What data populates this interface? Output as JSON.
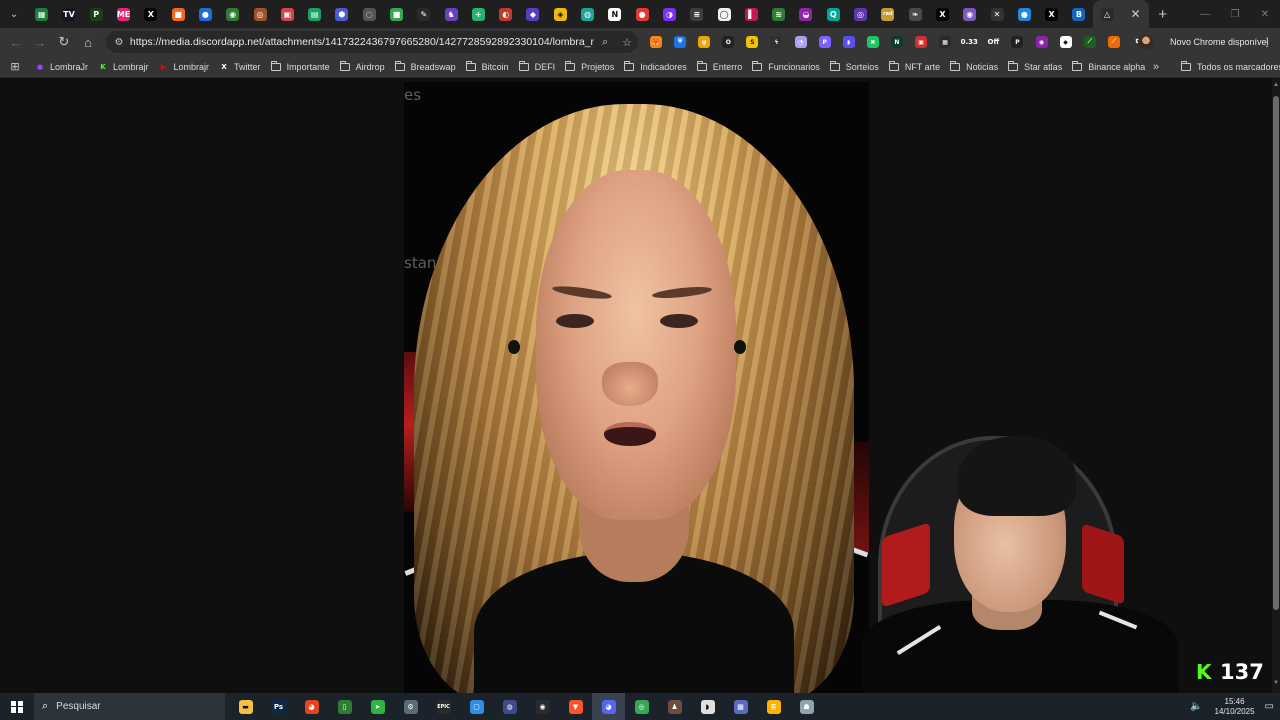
{
  "browser": {
    "tabs": [
      {
        "icon": "sheets-icon",
        "color": "#188038",
        "glyph": "▦"
      },
      {
        "icon": "tradingview-icon",
        "color": "#131722",
        "glyph": "TV"
      },
      {
        "icon": "pokemon-icon",
        "color": "#1e3d1e",
        "glyph": "P"
      },
      {
        "icon": "magiceden-icon",
        "color": "#e42575",
        "glyph": "ME"
      },
      {
        "icon": "x-icon",
        "color": "#000000",
        "glyph": "X"
      },
      {
        "icon": "orange-square-icon",
        "color": "#f26722",
        "glyph": "■"
      },
      {
        "icon": "drop-icon",
        "color": "#1c6fd6",
        "glyph": "●"
      },
      {
        "icon": "green-orb-icon",
        "color": "#2f7d32",
        "glyph": "◉"
      },
      {
        "icon": "bronze-coin-icon",
        "color": "#a0522d",
        "glyph": "◎"
      },
      {
        "icon": "red-square-icon",
        "color": "#d64545",
        "glyph": "▣"
      },
      {
        "icon": "green-sheet-icon",
        "color": "#1aa260",
        "glyph": "▤"
      },
      {
        "icon": "blue-hex-icon",
        "color": "#4a5bd6",
        "glyph": "⬢"
      },
      {
        "icon": "grey-circle-icon",
        "color": "#555555",
        "glyph": "◌"
      },
      {
        "icon": "green-tab-icon",
        "color": "#34a853",
        "glyph": "■"
      },
      {
        "icon": "quill-icon",
        "color": "#2a2a2a",
        "glyph": "✎"
      },
      {
        "icon": "purple-wizard-icon",
        "color": "#6a3fc1",
        "glyph": "♞"
      },
      {
        "icon": "green-plus-icon",
        "color": "#21b573",
        "glyph": "+"
      },
      {
        "icon": "swirl-icon",
        "color": "#c0392b",
        "glyph": "◐"
      },
      {
        "icon": "purple-diamond-icon",
        "color": "#5b3cc4",
        "glyph": "◆"
      },
      {
        "icon": "binance-icon",
        "color": "#f0b90b",
        "glyph": "◈"
      },
      {
        "icon": "teal-globe-icon",
        "color": "#1ba39c",
        "glyph": "◍"
      },
      {
        "icon": "notion-icon",
        "color": "#ffffff",
        "glyph": "N"
      },
      {
        "icon": "red-dot-icon",
        "color": "#e53935",
        "glyph": "●"
      },
      {
        "icon": "purple-moon-icon",
        "color": "#7b2ff7",
        "glyph": "◑"
      },
      {
        "icon": "lines-icon",
        "color": "#3d3d3d",
        "glyph": "≡"
      },
      {
        "icon": "white-circle-icon",
        "color": "#f2f2f2",
        "glyph": "◯"
      },
      {
        "icon": "magenta-bar-icon",
        "color": "#c2185b",
        "glyph": "▌"
      },
      {
        "icon": "green-wave-icon",
        "color": "#2e7d32",
        "glyph": "≋"
      },
      {
        "icon": "purple-swirl-icon",
        "color": "#8e24aa",
        "glyph": "◒"
      },
      {
        "icon": "teal-q-icon",
        "color": "#00a896",
        "glyph": "Q"
      },
      {
        "icon": "violet-token-icon",
        "color": "#5e35b1",
        "glyph": "◎"
      },
      {
        "icon": "rad-icon",
        "color": "#c99a2e",
        "glyph": "rad"
      },
      {
        "icon": "grey-leaf-icon",
        "color": "#4a4a4a",
        "glyph": "❧"
      },
      {
        "icon": "x-icon",
        "color": "#000000",
        "glyph": "X"
      },
      {
        "icon": "purple-ring-icon",
        "color": "#7e57c2",
        "glyph": "◉"
      },
      {
        "icon": "crossed-icon",
        "color": "#333333",
        "glyph": "✕"
      },
      {
        "icon": "blue-drop-icon",
        "color": "#1e88e5",
        "glyph": "●"
      },
      {
        "icon": "x-icon",
        "color": "#000000",
        "glyph": "X"
      },
      {
        "icon": "blue-b-icon",
        "color": "#1565c0",
        "glyph": "B"
      }
    ],
    "active_tab": {
      "icon": "drive-icon",
      "color": "#2a2a2a",
      "glyph": "△"
    },
    "url": "https://media.discordapp.net/attachments/1417322436797665280/1427728592892330104/lombra_rocha_da...",
    "extensions": [
      {
        "icon": "fox-icon",
        "color": "#f6851b",
        "glyph": "🦊"
      },
      {
        "icon": "shield-icon",
        "color": "#1a73e8",
        "glyph": "⛨"
      },
      {
        "icon": "phantom-icon",
        "color": "#f0a400",
        "glyph": "ψ"
      },
      {
        "icon": "o-icon",
        "color": "#222222",
        "glyph": "O"
      },
      {
        "icon": "s-icon",
        "color": "#f2c200",
        "glyph": "S"
      },
      {
        "icon": "lightning-icon",
        "color": "#303030",
        "glyph": "ϟ"
      },
      {
        "icon": "ghost-icon",
        "color": "#ab9ff2",
        "glyph": "◔"
      },
      {
        "icon": "p-icon",
        "color": "#7b61ff",
        "glyph": "P"
      },
      {
        "icon": "rabbit-icon",
        "color": "#5a4ff2",
        "glyph": "◗"
      },
      {
        "icon": "x-green-icon",
        "color": "#18c964",
        "glyph": "✖"
      },
      {
        "icon": "n-icon",
        "color": "#0c3b2e",
        "glyph": "N"
      },
      {
        "icon": "red-bag-icon",
        "color": "#d32f2f",
        "glyph": "▣"
      },
      {
        "icon": "qr-icon",
        "color": "#2a2a2a",
        "glyph": "▦"
      },
      {
        "icon": "counter-icon",
        "color": "#2a2a2a",
        "glyph": "0.33"
      },
      {
        "icon": "off-icon",
        "color": "#2a2a2a",
        "glyph": "Off"
      },
      {
        "icon": "p-black-icon",
        "color": "#212121",
        "glyph": "P"
      },
      {
        "icon": "violet-circle-icon",
        "color": "#8e24aa",
        "glyph": "◉"
      },
      {
        "icon": "diamond-icon",
        "color": "#ffffff",
        "glyph": "◆"
      },
      {
        "icon": "chart-icon",
        "color": "#1b5e20",
        "glyph": "⟋"
      },
      {
        "icon": "orange-slash-icon",
        "color": "#ef6c00",
        "glyph": "⟋"
      },
      {
        "icon": "puzzle-icon",
        "color": "#353535",
        "glyph": "⧉"
      }
    ],
    "update_label": "Novo Chrome disponível",
    "bookmarks": [
      {
        "type": "site",
        "label": "LombraJr",
        "icon": "purple-avatar-icon",
        "color": "#9146ff",
        "glyph": "●"
      },
      {
        "type": "site",
        "label": "Lombrajr",
        "icon": "kick-icon",
        "color": "#53fc18",
        "glyph": "K"
      },
      {
        "type": "site",
        "label": "Lombrajr",
        "icon": "youtube-icon",
        "color": "#ff0000",
        "glyph": "▶"
      },
      {
        "type": "site",
        "label": "Twitter",
        "icon": "x-icon",
        "color": "#ffffff",
        "glyph": "X"
      },
      {
        "type": "folder",
        "label": "Importante"
      },
      {
        "type": "folder",
        "label": "Airdrop"
      },
      {
        "type": "folder",
        "label": "Breadswap"
      },
      {
        "type": "folder",
        "label": "Bitcoin"
      },
      {
        "type": "folder",
        "label": "DEFI"
      },
      {
        "type": "folder",
        "label": "Projetos"
      },
      {
        "type": "folder",
        "label": "Indicadores"
      },
      {
        "type": "folder",
        "label": "Enterro"
      },
      {
        "type": "folder",
        "label": "Funcionarios"
      },
      {
        "type": "folder",
        "label": "Sorteios"
      },
      {
        "type": "folder",
        "label": "NFT arte"
      },
      {
        "type": "folder",
        "label": "Noticias"
      },
      {
        "type": "folder",
        "label": "Star atlas"
      },
      {
        "type": "folder",
        "label": "Binance alpha"
      }
    ],
    "all_bookmarks_label": "Todos os marcadores"
  },
  "video": {
    "ghost_text_top": "es",
    "ghost_text_mid": "stando"
  },
  "stream_overlay": {
    "viewer_count": "137",
    "kick_color": "#53fc18"
  },
  "taskbar": {
    "search_placeholder": "Pesquisar",
    "apps": [
      {
        "icon": "file-explorer-icon",
        "color": "#f4c145",
        "glyph": "▬",
        "active": false
      },
      {
        "icon": "photoshop-icon",
        "color": "#0b2a4a",
        "glyph": "Ps",
        "active": false
      },
      {
        "icon": "obs-like-icon",
        "color": "#e2461f",
        "glyph": "◕",
        "active": false
      },
      {
        "icon": "book-app-icon",
        "color": "#2e7d32",
        "glyph": "▯",
        "active": false
      },
      {
        "icon": "green-arrow-icon",
        "color": "#2fb344",
        "glyph": "➤",
        "active": false
      },
      {
        "icon": "steam-icon",
        "color": "#5a6b7a",
        "glyph": "⚙",
        "active": false
      },
      {
        "icon": "epic-games-icon",
        "color": "#2a2a2a",
        "glyph": "EPIC",
        "active": false
      },
      {
        "icon": "blue-app-icon",
        "color": "#2f8de4",
        "glyph": "▢",
        "active": false
      },
      {
        "icon": "launcher-icon",
        "color": "#3e4a8a",
        "glyph": "◍",
        "active": false
      },
      {
        "icon": "obs-icon",
        "color": "#2b2b2b",
        "glyph": "◉",
        "active": false
      },
      {
        "icon": "brave-icon",
        "color": "#fb542b",
        "glyph": "▼",
        "active": false
      },
      {
        "icon": "discord-icon",
        "color": "#5865f2",
        "glyph": "◕",
        "active": true
      },
      {
        "icon": "chrome-icon",
        "color": "#34a853",
        "glyph": "◎",
        "active": false
      },
      {
        "icon": "character-icon",
        "color": "#6d4c41",
        "glyph": "♟",
        "active": false
      },
      {
        "icon": "white-shape-icon",
        "color": "#e0e0e0",
        "glyph": "◗",
        "active": false
      },
      {
        "icon": "calculator-icon",
        "color": "#5c6bc0",
        "glyph": "▦",
        "active": false
      },
      {
        "icon": "stack-icon",
        "color": "#ffb300",
        "glyph": "≣",
        "active": false
      },
      {
        "icon": "alien-icon",
        "color": "#90a4ae",
        "glyph": "☗",
        "active": false
      }
    ],
    "time": "15:46",
    "date": "14/10/2025"
  }
}
